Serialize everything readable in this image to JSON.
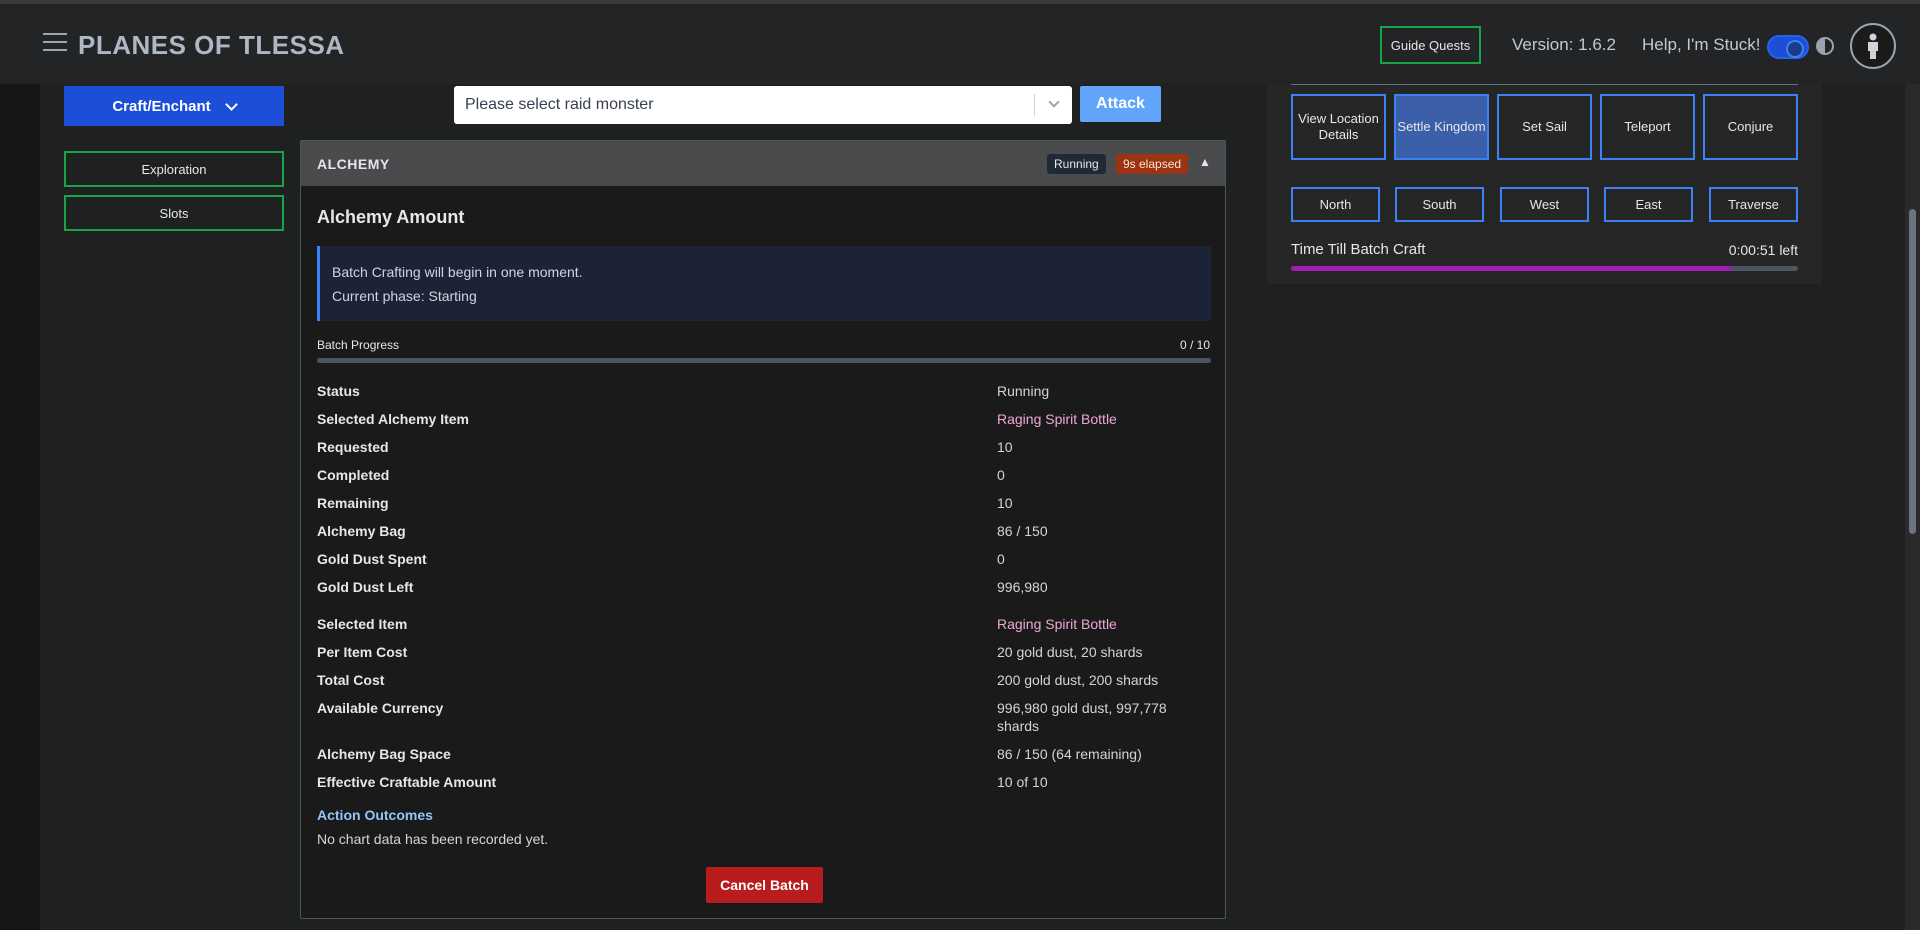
{
  "header": {
    "title": "PLANES OF TLESSA",
    "guide_quests": "Guide Quests",
    "version": "Version: 1.6.2",
    "help": "Help, I'm Stuck!"
  },
  "sidebar": {
    "craft_enchant": "Craft/Enchant",
    "items": [
      {
        "label": "Exploration"
      },
      {
        "label": "Slots"
      }
    ]
  },
  "raid": {
    "placeholder": "Please select raid monster",
    "attack": "Attack"
  },
  "alchemy": {
    "panel_title": "ALCHEMY",
    "status_badge": "Running",
    "elapsed_badge": "9s elapsed",
    "collapse_glyph": "▲",
    "section_title": "Alchemy Amount",
    "notice_line1": "Batch Crafting will begin in one moment.",
    "notice_line2": "Current phase: Starting",
    "progress_label": "Batch Progress",
    "progress_count": "0 / 10",
    "progress_fraction": 0,
    "rows": [
      {
        "key": "Status",
        "value": "Running"
      },
      {
        "key": "Selected Alchemy Item",
        "value": "Raging Spirit Bottle"
      },
      {
        "key": "Requested",
        "value": "10"
      },
      {
        "key": "Completed",
        "value": "0"
      },
      {
        "key": "Remaining",
        "value": "10"
      },
      {
        "key": "Alchemy Bag",
        "value": "86 / 150"
      },
      {
        "key": "Gold Dust Spent",
        "value": "0"
      },
      {
        "key": "Gold Dust Left",
        "value": "996,980"
      },
      {
        "key": "Selected Item",
        "value": "Raging Spirit Bottle"
      },
      {
        "key": "Per Item Cost",
        "value": "20 gold dust, 20 shards"
      },
      {
        "key": "Total Cost",
        "value": "200 gold dust, 200 shards"
      },
      {
        "key": "Available Currency",
        "value": "996,980 gold dust, 997,778 shards"
      },
      {
        "key": "Alchemy Bag Space",
        "value": "86 / 150 (64 remaining)"
      },
      {
        "key": "Effective Craftable Amount",
        "value": "10 of 10"
      }
    ],
    "outcomes_title": "Action Outcomes",
    "outcomes_text": "No chart data has been recorded yet.",
    "cancel": "Cancel Batch"
  },
  "map_actions": {
    "buttons": [
      {
        "label": "View Location Details"
      },
      {
        "label": "Settle Kingdom"
      },
      {
        "label": "Set Sail"
      },
      {
        "label": "Teleport"
      },
      {
        "label": "Conjure"
      }
    ],
    "directions": [
      {
        "label": "North"
      },
      {
        "label": "South"
      },
      {
        "label": "West"
      },
      {
        "label": "East"
      },
      {
        "label": "Traverse"
      }
    ],
    "timer_label": "Time Till Batch Craft",
    "timer_value": "0:00:51 left",
    "timer_fraction": 0.87
  },
  "colors": {
    "primary_blue": "#1d4ed8",
    "success_green": "#16a34a",
    "danger_red": "#b91c1c",
    "accent_pink": "#f0a8d6",
    "timer_purple": "#a21caf"
  }
}
